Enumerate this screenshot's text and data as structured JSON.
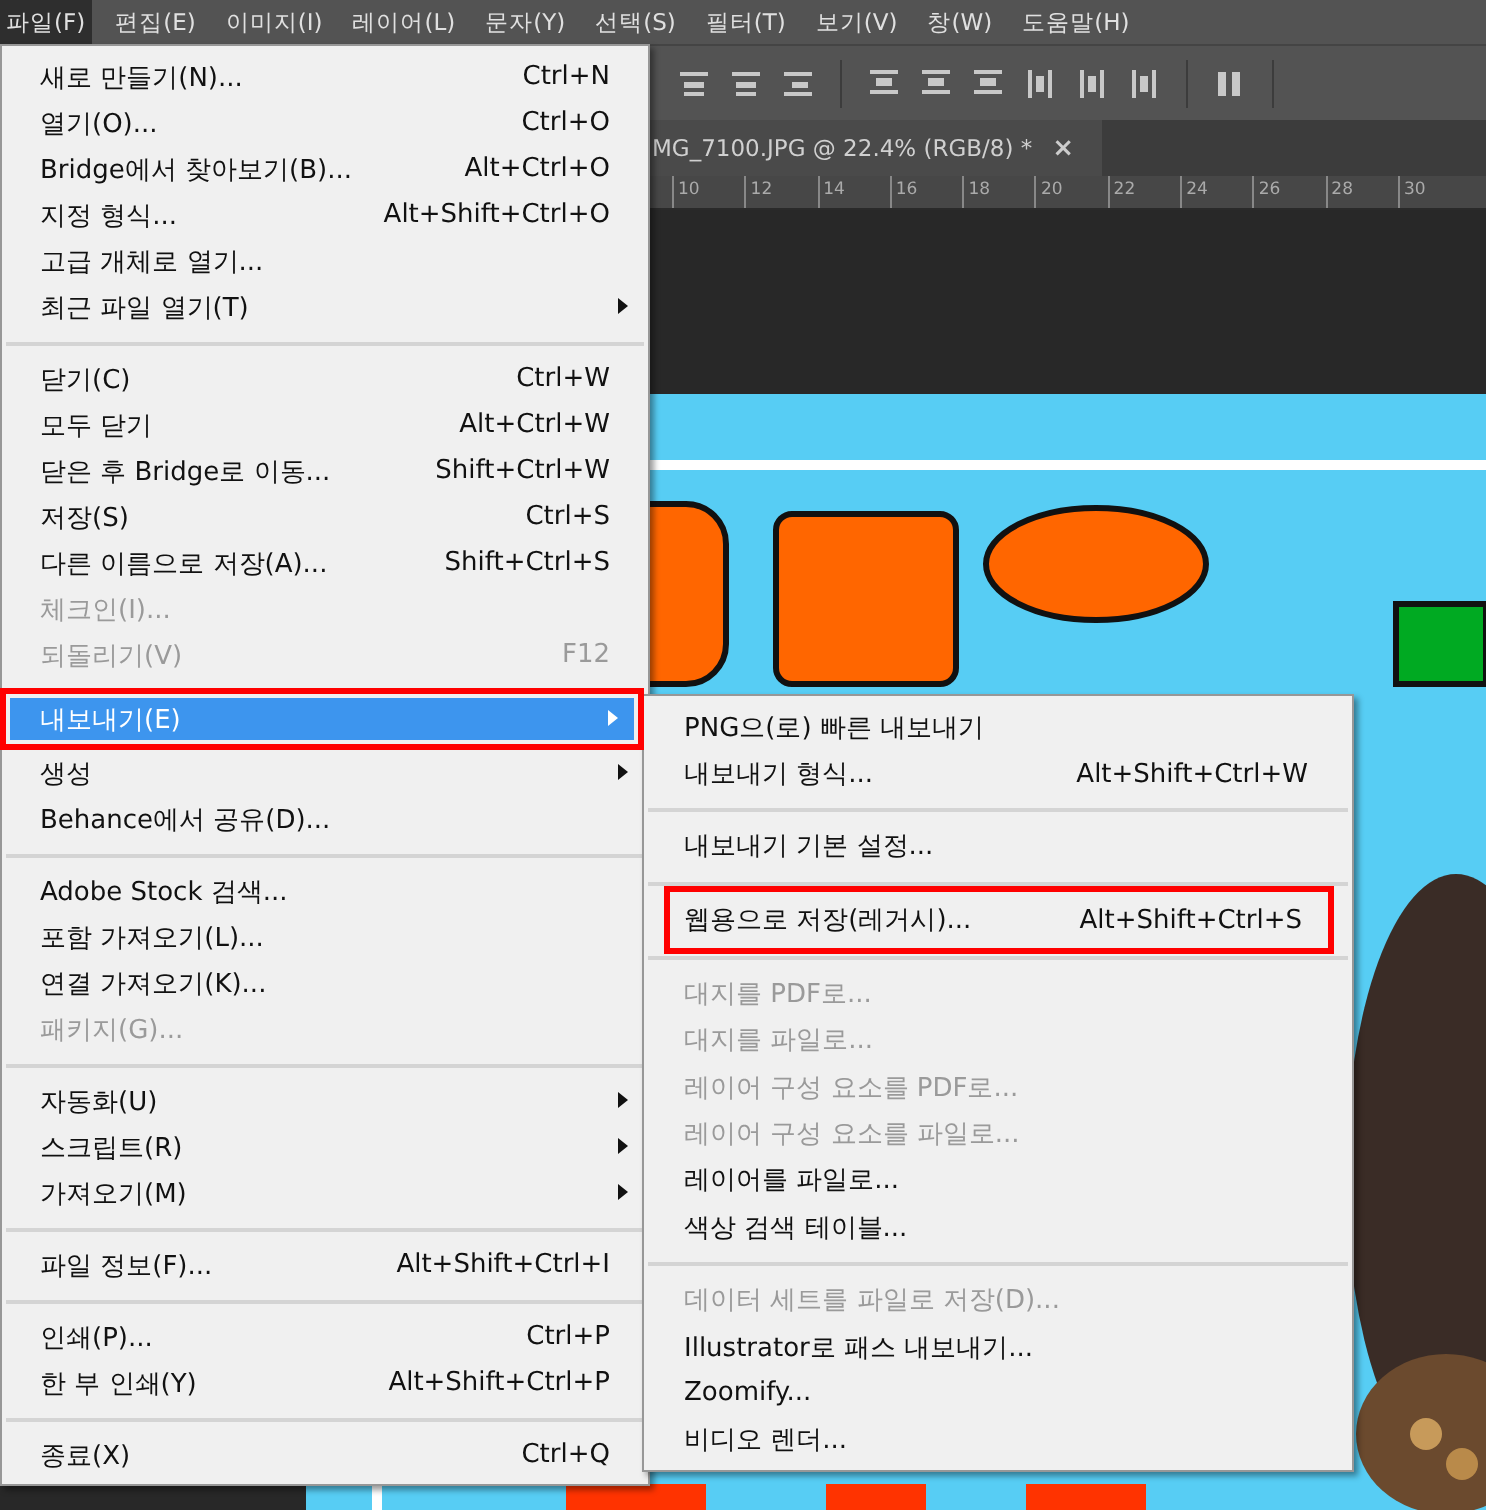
{
  "menubar": [
    {
      "label": "파일(F)",
      "selected": true
    },
    {
      "label": "편집(E)",
      "selected": false
    },
    {
      "label": "이미지(I)",
      "selected": false
    },
    {
      "label": "레이어(L)",
      "selected": false
    },
    {
      "label": "문자(Y)",
      "selected": false
    },
    {
      "label": "선택(S)",
      "selected": false
    },
    {
      "label": "필터(T)",
      "selected": false
    },
    {
      "label": "보기(V)",
      "selected": false
    },
    {
      "label": "창(W)",
      "selected": false
    },
    {
      "label": "도움말(H)",
      "selected": false
    }
  ],
  "document_tab": {
    "title": "MG_7100.JPG @ 22.4% (RGB/8) *",
    "close": "×"
  },
  "ruler": {
    "labels": [
      "10",
      "12",
      "14",
      "16",
      "18",
      "20",
      "22",
      "24",
      "26",
      "28",
      "30"
    ]
  },
  "file_menu": {
    "items": [
      {
        "kind": "item",
        "label": "새로 만들기(N)...",
        "shortcut": "Ctrl+N",
        "submenu": false,
        "disabled": false,
        "selected": false,
        "outlined": false
      },
      {
        "kind": "item",
        "label": "열기(O)...",
        "shortcut": "Ctrl+O",
        "submenu": false,
        "disabled": false,
        "selected": false,
        "outlined": false
      },
      {
        "kind": "item",
        "label": "Bridge에서 찾아보기(B)...",
        "shortcut": "Alt+Ctrl+O",
        "submenu": false,
        "disabled": false,
        "selected": false,
        "outlined": false
      },
      {
        "kind": "item",
        "label": "지정 형식...",
        "shortcut": "Alt+Shift+Ctrl+O",
        "submenu": false,
        "disabled": false,
        "selected": false,
        "outlined": false
      },
      {
        "kind": "item",
        "label": "고급 개체로 열기...",
        "submenu": false,
        "disabled": false,
        "selected": false,
        "outlined": false
      },
      {
        "kind": "item",
        "label": "최근 파일 열기(T)",
        "submenu": true,
        "disabled": false,
        "selected": false,
        "outlined": false
      },
      {
        "kind": "separator"
      },
      {
        "kind": "item",
        "label": "닫기(C)",
        "shortcut": "Ctrl+W",
        "submenu": false,
        "disabled": false,
        "selected": false,
        "outlined": false
      },
      {
        "kind": "item",
        "label": "모두 닫기",
        "shortcut": "Alt+Ctrl+W",
        "submenu": false,
        "disabled": false,
        "selected": false,
        "outlined": false
      },
      {
        "kind": "item",
        "label": "닫은 후 Bridge로 이동...",
        "shortcut": "Shift+Ctrl+W",
        "submenu": false,
        "disabled": false,
        "selected": false,
        "outlined": false
      },
      {
        "kind": "item",
        "label": "저장(S)",
        "shortcut": "Ctrl+S",
        "submenu": false,
        "disabled": false,
        "selected": false,
        "outlined": false
      },
      {
        "kind": "item",
        "label": "다른 이름으로 저장(A)...",
        "shortcut": "Shift+Ctrl+S",
        "submenu": false,
        "disabled": false,
        "selected": false,
        "outlined": false
      },
      {
        "kind": "item",
        "label": "체크인(I)...",
        "submenu": false,
        "disabled": true,
        "selected": false,
        "outlined": false
      },
      {
        "kind": "item",
        "label": "되돌리기(V)",
        "shortcut": "F12",
        "submenu": false,
        "disabled": true,
        "selected": false,
        "outlined": false
      },
      {
        "kind": "separator"
      },
      {
        "kind": "item",
        "label": "내보내기(E)",
        "submenu": true,
        "disabled": false,
        "selected": true,
        "outlined": true
      },
      {
        "kind": "item",
        "label": "생성",
        "submenu": true,
        "disabled": false,
        "selected": false,
        "outlined": false
      },
      {
        "kind": "item",
        "label": "Behance에서 공유(D)...",
        "submenu": false,
        "disabled": false,
        "selected": false,
        "outlined": false
      },
      {
        "kind": "separator"
      },
      {
        "kind": "item",
        "label": "Adobe Stock 검색...",
        "submenu": false,
        "disabled": false,
        "selected": false,
        "outlined": false
      },
      {
        "kind": "item",
        "label": "포함 가져오기(L)...",
        "submenu": false,
        "disabled": false,
        "selected": false,
        "outlined": false
      },
      {
        "kind": "item",
        "label": "연결 가져오기(K)...",
        "submenu": false,
        "disabled": false,
        "selected": false,
        "outlined": false
      },
      {
        "kind": "item",
        "label": "패키지(G)...",
        "submenu": false,
        "disabled": true,
        "selected": false,
        "outlined": false
      },
      {
        "kind": "separator"
      },
      {
        "kind": "item",
        "label": "자동화(U)",
        "submenu": true,
        "disabled": false,
        "selected": false,
        "outlined": false
      },
      {
        "kind": "item",
        "label": "스크립트(R)",
        "submenu": true,
        "disabled": false,
        "selected": false,
        "outlined": false
      },
      {
        "kind": "item",
        "label": "가져오기(M)",
        "submenu": true,
        "disabled": false,
        "selected": false,
        "outlined": false
      },
      {
        "kind": "separator"
      },
      {
        "kind": "item",
        "label": "파일 정보(F)...",
        "shortcut": "Alt+Shift+Ctrl+I",
        "submenu": false,
        "disabled": false,
        "selected": false,
        "outlined": false
      },
      {
        "kind": "separator"
      },
      {
        "kind": "item",
        "label": "인쇄(P)...",
        "shortcut": "Ctrl+P",
        "submenu": false,
        "disabled": false,
        "selected": false,
        "outlined": false
      },
      {
        "kind": "item",
        "label": "한 부 인쇄(Y)",
        "shortcut": "Alt+Shift+Ctrl+P",
        "submenu": false,
        "disabled": false,
        "selected": false,
        "outlined": false
      },
      {
        "kind": "separator"
      },
      {
        "kind": "item",
        "label": "종료(X)",
        "shortcut": "Ctrl+Q",
        "submenu": false,
        "disabled": false,
        "selected": false,
        "outlined": false
      }
    ]
  },
  "export_submenu": {
    "items": [
      {
        "kind": "item",
        "label": "PNG으(로) 빠른 내보내기",
        "disabled": false,
        "outlined": false
      },
      {
        "kind": "item",
        "label": "내보내기 형식...",
        "shortcut": "Alt+Shift+Ctrl+W",
        "disabled": false,
        "outlined": false
      },
      {
        "kind": "separator"
      },
      {
        "kind": "item",
        "label": "내보내기 기본 설정...",
        "disabled": false,
        "outlined": false
      },
      {
        "kind": "separator"
      },
      {
        "kind": "item",
        "label": "웹용으로 저장(레거시)...",
        "shortcut": "Alt+Shift+Ctrl+S",
        "disabled": false,
        "outlined": true
      },
      {
        "kind": "separator"
      },
      {
        "kind": "item",
        "label": "대지를 PDF로...",
        "disabled": true,
        "outlined": false
      },
      {
        "kind": "item",
        "label": "대지를 파일로...",
        "disabled": true,
        "outlined": false
      },
      {
        "kind": "item",
        "label": "레이어 구성 요소를 PDF로...",
        "disabled": true,
        "outlined": false
      },
      {
        "kind": "item",
        "label": "레이어 구성 요소를 파일로...",
        "disabled": true,
        "outlined": false
      },
      {
        "kind": "item",
        "label": "레이어를 파일로...",
        "disabled": false,
        "outlined": false
      },
      {
        "kind": "item",
        "label": "색상 검색 테이블...",
        "disabled": false,
        "outlined": false
      },
      {
        "kind": "separator"
      },
      {
        "kind": "item",
        "label": "데이터 세트를 파일로 저장(D)...",
        "disabled": true,
        "outlined": false
      },
      {
        "kind": "item",
        "label": "Illustrator로 패스 내보내기...",
        "disabled": false,
        "outlined": false
      },
      {
        "kind": "item",
        "label": "Zoomify...",
        "disabled": false,
        "outlined": false
      },
      {
        "kind": "item",
        "label": "비디오 렌더...",
        "disabled": false,
        "outlined": false
      }
    ]
  }
}
